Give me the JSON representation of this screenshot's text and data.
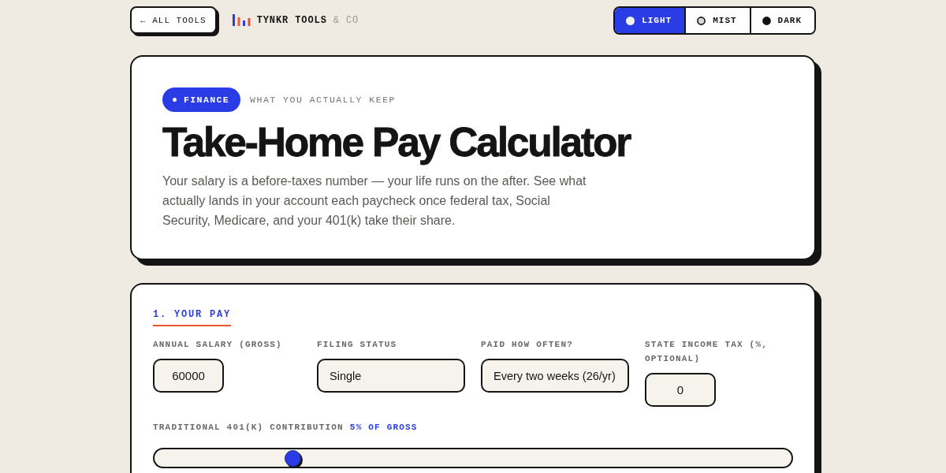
{
  "nav": {
    "back_button": "← ALL TOOLS",
    "brand": {
      "name": "TYNKR TOOLS",
      "suffix": "& CO"
    }
  },
  "theme_toggle": [
    {
      "label": "LIGHT",
      "selected": true,
      "color": "#f1f1f6"
    },
    {
      "label": "MIST",
      "selected": false,
      "color": "#d8d8d6"
    },
    {
      "label": "DARK",
      "selected": false,
      "color": "#111111"
    }
  ],
  "hero": {
    "badge": "FINANCE",
    "tagline": "WHAT YOU ACTUALLY KEEP",
    "title": "Take-Home Pay Calculator",
    "description": "Your salary is a before-taxes number — your life runs on the after. See what actually lands in your account each paycheck once federal tax, Social Security, Medicare, and your 401(k) take their share."
  },
  "section": {
    "title": "1. YOUR PAY",
    "fields": [
      {
        "kind": "number",
        "label": "ANNUAL SALARY (GROSS)",
        "value": "60000"
      },
      {
        "kind": "select",
        "label": "FILING STATUS",
        "value": "Single"
      },
      {
        "kind": "select",
        "label": "PAID HOW OFTEN?",
        "value": "Every two weeks (26/yr)"
      },
      {
        "kind": "number",
        "label": "STATE INCOME TAX (%, OPTIONAL)",
        "value": "0"
      }
    ],
    "contribution": {
      "label": "TRADITIONAL 401(K) CONTRIBUTION",
      "value": "5% OF GROSS",
      "level": 0.21
    }
  }
}
